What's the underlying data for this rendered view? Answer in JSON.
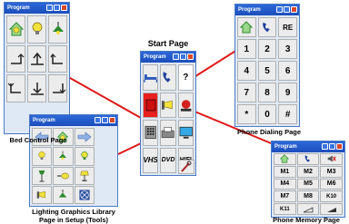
{
  "window_title": "Program",
  "captions": {
    "start_page": "Start Page",
    "bed_control": "Bed Control Page",
    "phone_dialing": "Phone Dialing Page",
    "phone_memory": "Phone Memory Page",
    "lighting_line1": "Lighting Graphics Library",
    "lighting_line2": "Page in Setup (Tools)"
  },
  "start_page": {
    "question_mark": "?",
    "vhs": "VHS",
    "dvd": "DVD",
    "hifi": "HIFI"
  },
  "phone_dialing": {
    "redial": "RE",
    "keys": [
      "1",
      "2",
      "3",
      "4",
      "5",
      "6",
      "7",
      "8",
      "9",
      "*",
      "0",
      "#"
    ]
  },
  "phone_memory": {
    "memory_keys": [
      "M1",
      "M2",
      "M3",
      "M4",
      "M5",
      "M6",
      "M7",
      "M8",
      "K10"
    ],
    "last_key": "K11"
  },
  "icons": [
    "bed-icon",
    "phone-icon",
    "light-bulb-icon",
    "ceiling-lamp-icon",
    "arrow-icon",
    "speaker-mute-icon",
    "alarm-icon",
    "tv-icon",
    "keypad-icon",
    "fax-icon",
    "tools-icon",
    "floor-lamp-icon",
    "fan-icon",
    "spotlight-icon",
    "table-lamp-icon",
    "wall-lamp-icon"
  ],
  "colors": {
    "connector": "#e01818",
    "titlebar": "#2258cf",
    "panel": "#dfe9f5",
    "phone_icon": "#1f3f9e",
    "bulb": "#f2e23a",
    "house_icon": "#2f8a2f"
  }
}
